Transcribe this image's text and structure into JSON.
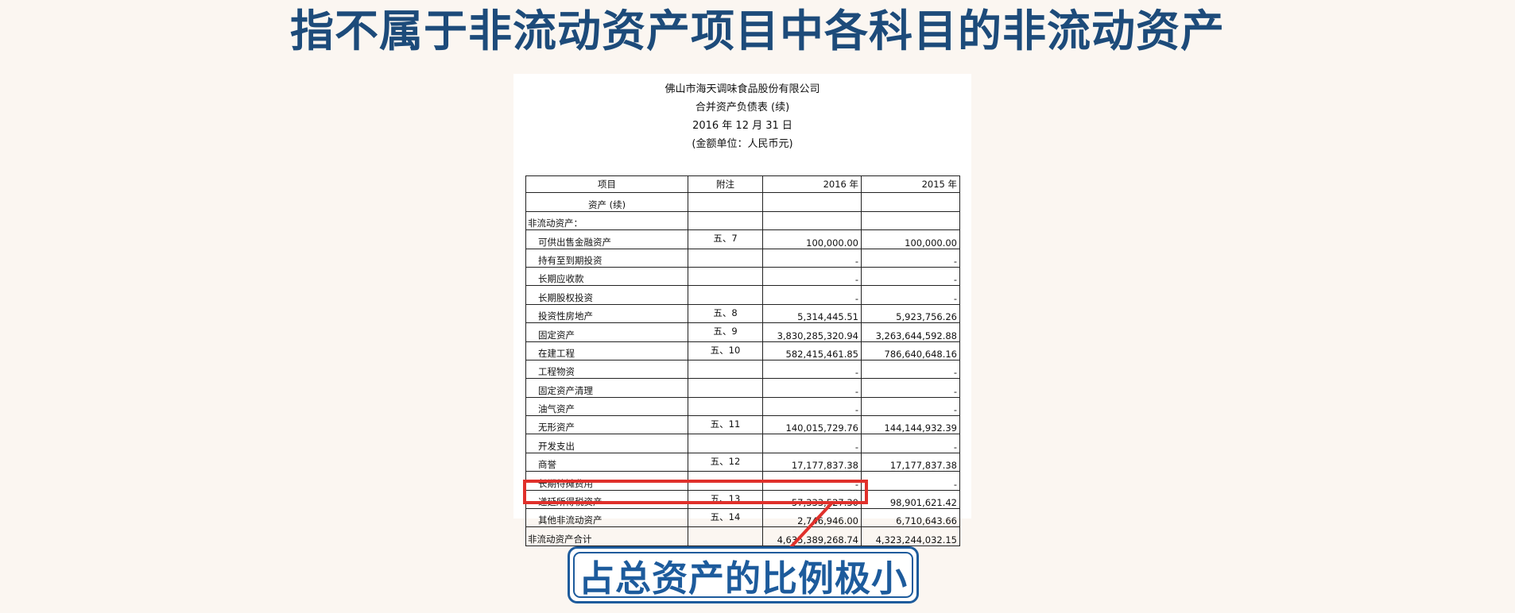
{
  "slide": {
    "title": "指不属于非流动资产项目中各科目的非流动资产",
    "callout": "占总资产的比例极小",
    "highlight_color": "#e0302b",
    "title_color": "#1d4b7a"
  },
  "document": {
    "company": "佛山市海天调味食品股份有限公司",
    "statement": "合并资产负债表 (续)",
    "date": "2016 年 12 月 31 日",
    "unit": "(金额单位：人民币元)",
    "headers": [
      "项目",
      "附注",
      "2016 年",
      "2015 年"
    ],
    "rows": [
      {
        "label": "资产 (续)",
        "note": "",
        "y2016": "",
        "y2015": ""
      },
      {
        "label": "非流动资产：",
        "note": "",
        "y2016": "",
        "y2015": ""
      },
      {
        "label": "可供出售金融资产",
        "note": "五、7",
        "y2016": "100,000.00",
        "y2015": "100,000.00"
      },
      {
        "label": "持有至到期投资",
        "note": "",
        "y2016": "-",
        "y2015": "-"
      },
      {
        "label": "长期应收款",
        "note": "",
        "y2016": "-",
        "y2015": "-"
      },
      {
        "label": "长期股权投资",
        "note": "",
        "y2016": "-",
        "y2015": "-"
      },
      {
        "label": "投资性房地产",
        "note": "五、8",
        "y2016": "5,314,445.51",
        "y2015": "5,923,756.26"
      },
      {
        "label": "固定资产",
        "note": "五、9",
        "y2016": "3,830,285,320.94",
        "y2015": "3,263,644,592.88"
      },
      {
        "label": "在建工程",
        "note": "五、10",
        "y2016": "582,415,461.85",
        "y2015": "786,640,648.16"
      },
      {
        "label": "工程物资",
        "note": "",
        "y2016": "-",
        "y2015": "-"
      },
      {
        "label": "固定资产清理",
        "note": "",
        "y2016": "-",
        "y2015": "-"
      },
      {
        "label": "油气资产",
        "note": "",
        "y2016": "-",
        "y2015": "-"
      },
      {
        "label": "无形资产",
        "note": "五、11",
        "y2016": "140,015,729.76",
        "y2015": "144,144,932.39"
      },
      {
        "label": "开发支出",
        "note": "",
        "y2016": "-",
        "y2015": "-"
      },
      {
        "label": "商誉",
        "note": "五、12",
        "y2016": "17,177,837.38",
        "y2015": "17,177,837.38"
      },
      {
        "label": "长期待摊费用",
        "note": "",
        "y2016": "-",
        "y2015": "-"
      },
      {
        "label": "递延所得税资产",
        "note": "五、13",
        "y2016": "57,333,527.30",
        "y2015": "98,901,621.42"
      },
      {
        "label": "其他非流动资产",
        "note": "五、14",
        "y2016": "2,746,946.00",
        "y2015": "6,710,643.66"
      },
      {
        "label": "非流动资产合计",
        "note": "",
        "y2016": "4,635,389,268.74",
        "y2015": "4,323,244,032.15"
      }
    ]
  }
}
